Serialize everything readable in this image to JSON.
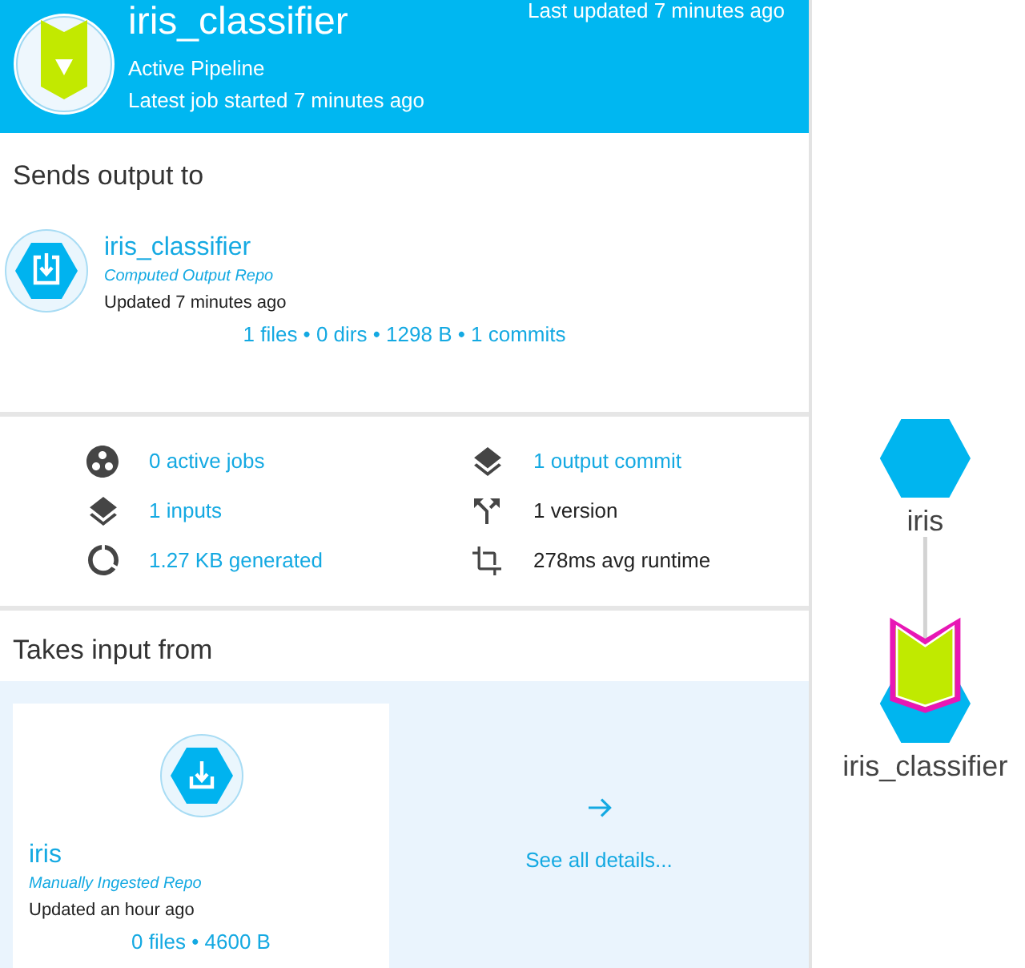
{
  "header": {
    "title": "iris_classifier",
    "status": "Active Pipeline",
    "latest_job": "Latest job started 7 minutes ago",
    "last_updated": "Last updated 7 minutes ago"
  },
  "output": {
    "heading": "Sends output to",
    "repo": {
      "name": "iris_classifier",
      "repo_type": "Computed Output Repo",
      "updated": "Updated 7 minutes ago",
      "stats": "1 files • 0 dirs • 1298 B • 1 commits"
    }
  },
  "stats": [
    {
      "kind": "jobs",
      "text": "0 active jobs",
      "link": true
    },
    {
      "kind": "layers",
      "text": "1 output commit",
      "link": true
    },
    {
      "kind": "layers",
      "text": "1 inputs",
      "link": true
    },
    {
      "kind": "fork",
      "text": "1 version",
      "link": false
    },
    {
      "kind": "usage",
      "text": "1.27 KB generated",
      "link": true
    },
    {
      "kind": "crop",
      "text": "278ms avg runtime",
      "link": false
    }
  ],
  "input": {
    "heading": "Takes input from",
    "repos": [
      {
        "name": "iris",
        "repo_type": "Manually Ingested Repo",
        "updated": "Updated an hour ago",
        "stats": "0 files • 4600 B"
      }
    ],
    "details_link": "See all details..."
  },
  "dag": {
    "nodes": [
      {
        "kind": "repo",
        "label": "iris",
        "selected": false
      },
      {
        "kind": "pipeline",
        "label": "iris_classifier",
        "selected": true
      }
    ]
  }
}
